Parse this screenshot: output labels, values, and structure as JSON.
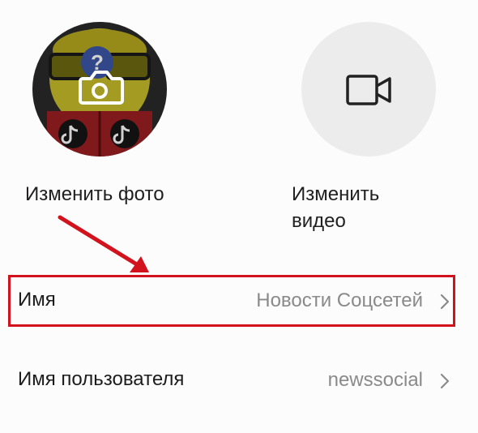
{
  "media": {
    "change_photo_label": "Изменить фото",
    "change_video_label": "Изменить видео"
  },
  "rows": {
    "name": {
      "label": "Имя",
      "value": "Новости Соцсетей"
    },
    "username": {
      "label": "Имя пользователя",
      "value": "newssocial"
    }
  },
  "colors": {
    "highlight": "#d2131e",
    "arrow": "#d2131e",
    "video_circle": "#ececec",
    "value_text": "#8a8a8a"
  },
  "icons": {
    "photo": "camera-icon",
    "video": "video-camera-icon",
    "chevron": "chevron-right-icon"
  }
}
